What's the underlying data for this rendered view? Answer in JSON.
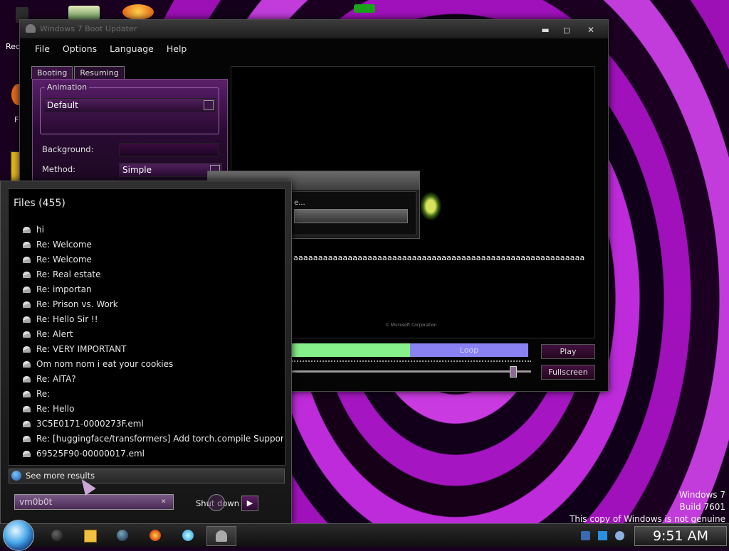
{
  "desktop": {
    "left_icon_label_partial": "Rec",
    "left_icon_label_partial_2": "F"
  },
  "main_window": {
    "title": "Windows 7 Boot Updater",
    "menu": [
      "File",
      "Options",
      "Language",
      "Help"
    ],
    "tabs": [
      "Booting",
      "Resuming"
    ],
    "animation_group_label": "Animation",
    "animation_value": "Default",
    "background_label": "Background:",
    "method_label": "Method:",
    "method_value": "Simple",
    "preview_text": "aaaaaaaaaaaaaaaaaaaaaaaaaaaaaaaaaaaaaaaaaaaaaaaaaaaaaaaaaaa",
    "preview_copyright": "© Microsoft Corporation",
    "loop_label": "Loop",
    "play_label": "Play",
    "fullscreen_label": "Fullscreen"
  },
  "mini_dialog": {
    "body_text_partial": "e..."
  },
  "search_panel": {
    "header": "Files (455)",
    "results": [
      "hi",
      "Re: Welcome",
      "Re: Welcome",
      "Re: Real estate",
      "Re: importan",
      "Re: Prison vs. Work",
      "Re: Hello Sir !!",
      "Re: Alert",
      "Re: VERY IMPORTANT",
      "Om nom nom i eat your cookies",
      "Re: AITA?",
      "Re:",
      "Re: Hello",
      "3C5E0171-0000273F.eml",
      "Re: [huggingface/transformers] Add torch.compile Support For...",
      "69525F90-00000017.eml"
    ],
    "see_more_label": "See more results",
    "search_value": "vm0b0t",
    "shutdown_label": "Shut down"
  },
  "watermark": {
    "line1": "Windows 7",
    "line2": "Build 7601",
    "line3": "This copy of Windows is not genuine"
  },
  "taskbar": {
    "clock": "9:51 AM",
    "pinned_icons": [
      "app-icon",
      "media-player-icon",
      "browser-icon",
      "firefox-icon",
      "ie-icon",
      "boot-updater-icon"
    ]
  }
}
